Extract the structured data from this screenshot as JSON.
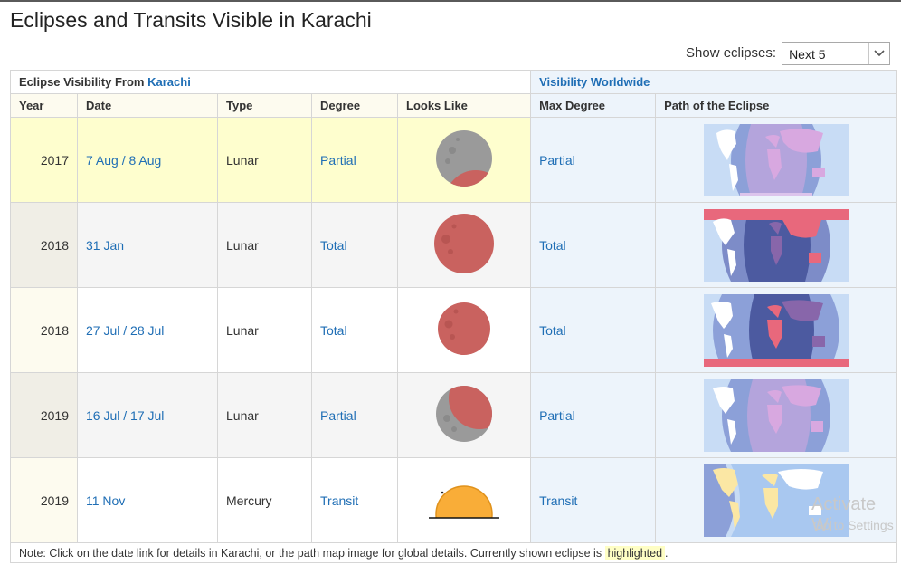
{
  "page": {
    "title": "Eclipses and Transits Visible in Karachi"
  },
  "controls": {
    "show_label": "Show eclipses:",
    "selected": "Next 5"
  },
  "table": {
    "local_heading_prefix": "Eclipse Visibility From",
    "local_city": "Karachi",
    "world_heading": "Visibility Worldwide",
    "columns": [
      "Year",
      "Date",
      "Type",
      "Degree",
      "Looks Like",
      "Max Degree",
      "Path of the Eclipse"
    ],
    "rows": [
      {
        "year": "2017",
        "date": "7 Aug / 8 Aug",
        "type": "Lunar",
        "degree": "Partial",
        "max_degree": "Partial",
        "highlighted": true
      },
      {
        "year": "2018",
        "date": "31 Jan",
        "type": "Lunar",
        "degree": "Total",
        "max_degree": "Total",
        "highlighted": false
      },
      {
        "year": "2018",
        "date": "27 Jul / 28 Jul",
        "type": "Lunar",
        "degree": "Total",
        "max_degree": "Total",
        "highlighted": false
      },
      {
        "year": "2019",
        "date": "16 Jul / 17 Jul",
        "type": "Lunar",
        "degree": "Partial",
        "max_degree": "Partial",
        "highlighted": false
      },
      {
        "year": "2019",
        "date": "11 Nov",
        "type": "Mercury",
        "degree": "Transit",
        "max_degree": "Transit",
        "highlighted": false
      }
    ]
  },
  "note": {
    "text": "Note: Click on the date link for details in Karachi, or the path map image for global details. Currently shown eclipse is",
    "highlight_word": "highlighted",
    "end": "."
  },
  "watermark": {
    "line1": "Activate Wi",
    "line2": "Go to Settings"
  },
  "colors": {
    "link": "#1f6eb5",
    "highlight": "#fefece",
    "moon_red": "#c9625f",
    "moon_gray": "#9a9a9a",
    "sun": "#f9ad38"
  }
}
